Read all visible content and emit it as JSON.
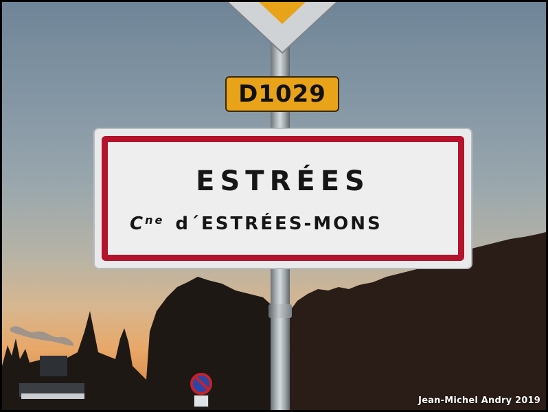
{
  "photo": {
    "route_plate": "D1029",
    "town_sign": {
      "town_name": "ESTRÉES",
      "commune_prefix": "C",
      "commune_prefix_sup": "ne",
      "commune_name": "d´ESTRÉES-MONS"
    },
    "watermark": "Jean-Michel Andry 2019"
  },
  "colors": {
    "sign_border_red": "#b5122b",
    "route_plate_yellow": "#e8a319",
    "sky_top": "#6f8597",
    "sky_horizon": "#e8a868"
  }
}
